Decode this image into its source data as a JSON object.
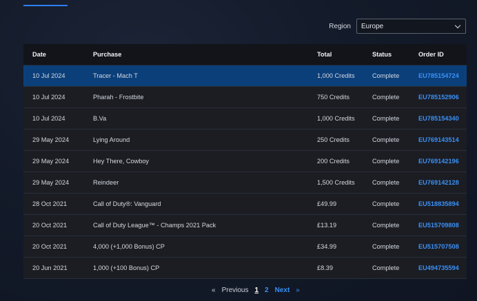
{
  "filter": {
    "region_label": "Region",
    "region_value": "Europe"
  },
  "table": {
    "headers": {
      "date": "Date",
      "purchase": "Purchase",
      "total": "Total",
      "status": "Status",
      "order_id": "Order ID"
    },
    "rows": [
      {
        "date": "10 Jul 2024",
        "purchase": "Tracer - Mach T",
        "total": "1,000 Credits",
        "status": "Complete",
        "order_id": "EU785154724"
      },
      {
        "date": "10 Jul 2024",
        "purchase": "Pharah - Frostbite",
        "total": "750 Credits",
        "status": "Complete",
        "order_id": "EU785152906"
      },
      {
        "date": "10 Jul 2024",
        "purchase": "B.Va",
        "total": "1,000 Credits",
        "status": "Complete",
        "order_id": "EU785154340"
      },
      {
        "date": "29 May 2024",
        "purchase": "Lying Around",
        "total": "250 Credits",
        "status": "Complete",
        "order_id": "EU769143514"
      },
      {
        "date": "29 May 2024",
        "purchase": "Hey There, Cowboy",
        "total": "200 Credits",
        "status": "Complete",
        "order_id": "EU769142196"
      },
      {
        "date": "29 May 2024",
        "purchase": "Reindeer",
        "total": "1,500 Credits",
        "status": "Complete",
        "order_id": "EU769142128"
      },
      {
        "date": "28 Oct 2021",
        "purchase": "Call of Duty®: Vanguard",
        "total": "£49.99",
        "status": "Complete",
        "order_id": "EU518835894"
      },
      {
        "date": "20 Oct 2021",
        "purchase": "Call of Duty League™ - Champs 2021 Pack",
        "total": "£13.19",
        "status": "Complete",
        "order_id": "EU515709808"
      },
      {
        "date": "20 Oct 2021",
        "purchase": "4,000 (+1,000 Bonus) CP",
        "total": "£34.99",
        "status": "Complete",
        "order_id": "EU515707508"
      },
      {
        "date": "20 Jun 2021",
        "purchase": "1,000 (+100 Bonus) CP",
        "total": "£8.39",
        "status": "Complete",
        "order_id": "EU494735594"
      }
    ]
  },
  "pagination": {
    "first": "«",
    "previous": "Previous",
    "page_1": "1",
    "page_2": "2",
    "next": "Next",
    "last": "»"
  },
  "colors": {
    "accent": "#3b8ff5",
    "selected_row": "#0b3f7a"
  }
}
